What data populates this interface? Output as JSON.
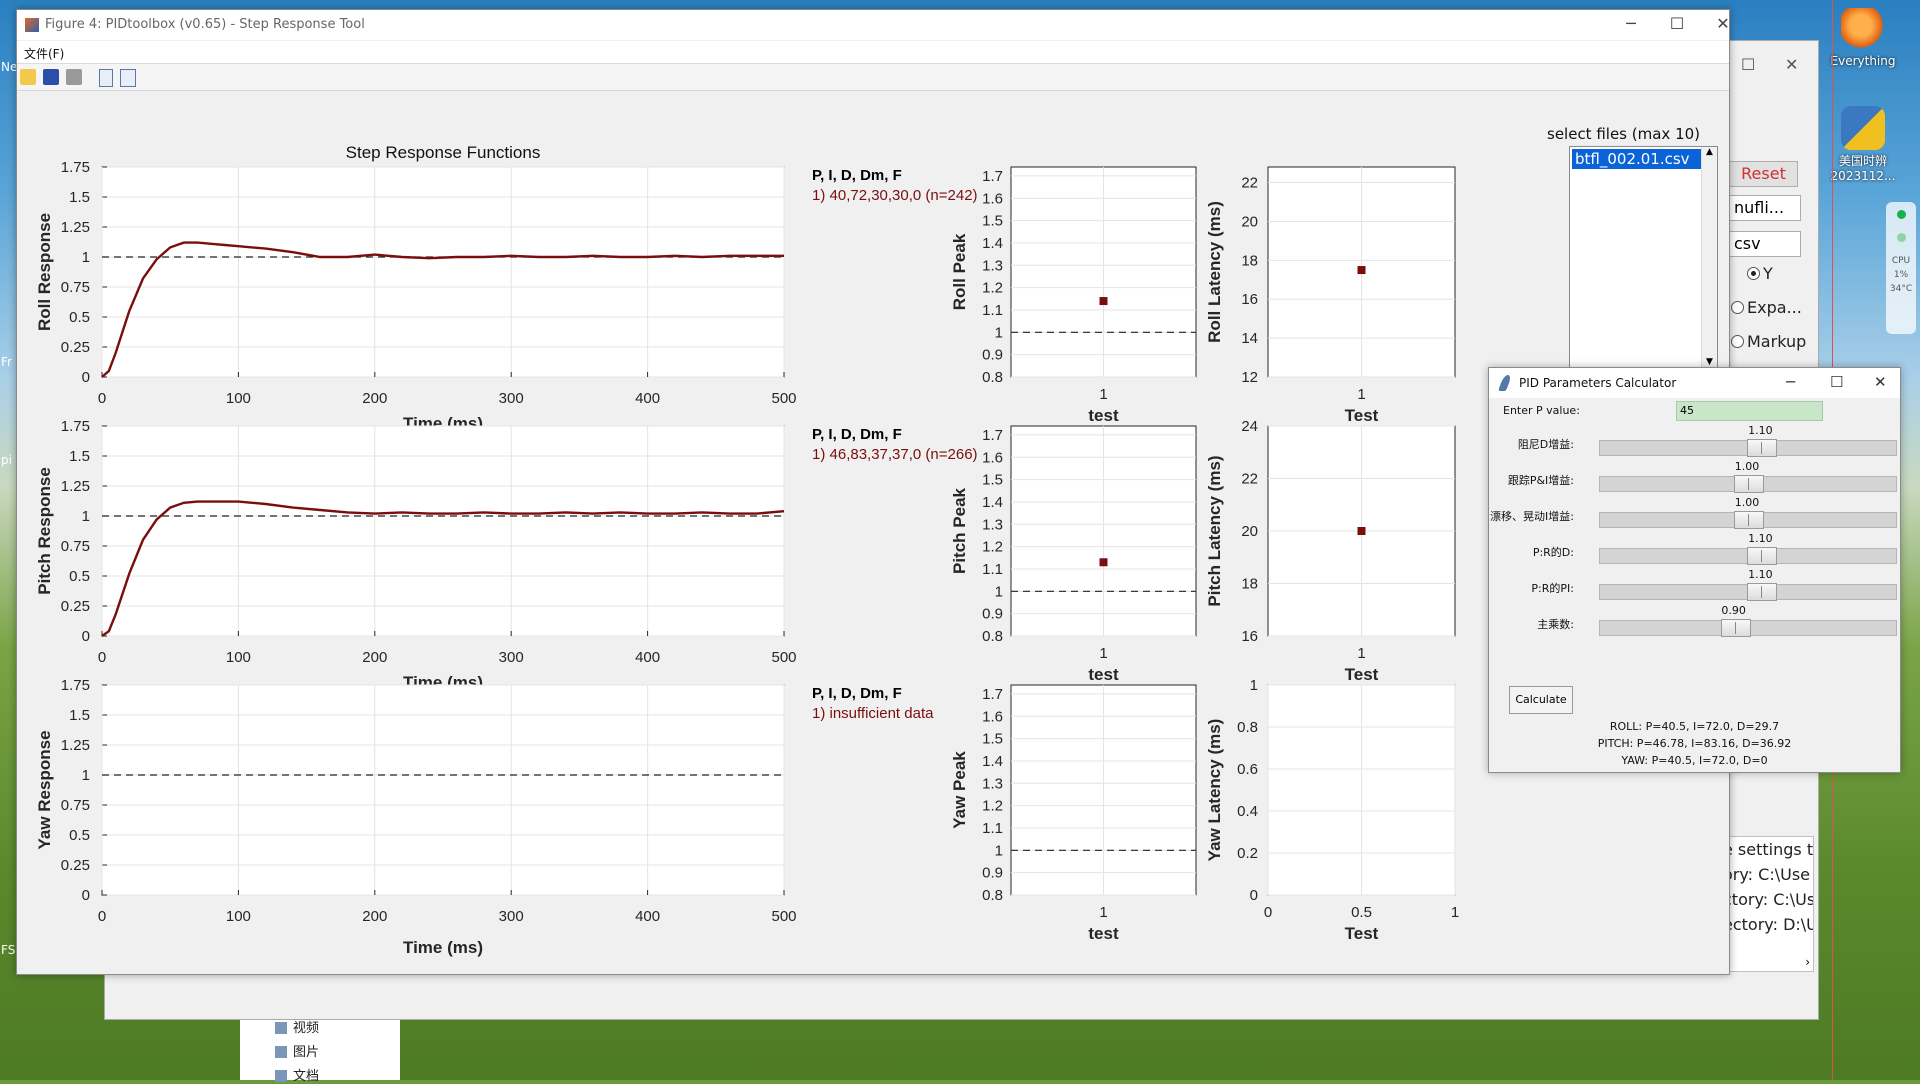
{
  "desktop": {
    "icons": [
      {
        "label": "Everything",
        "glyph_color": "#f08020"
      },
      {
        "label": "美国时辨",
        "sublabel": "2023112...",
        "glyph_color": "#3a78c0"
      }
    ],
    "side_fragments": [
      "Ne",
      "Fr",
      "pi",
      "FS"
    ],
    "cpu_widget": {
      "label": "CPU",
      "value": "1%",
      "temp": "34°C"
    }
  },
  "explorer": {
    "items": [
      "视频",
      "图片",
      "文档"
    ]
  },
  "bg_window": {
    "reset_label": "Reset",
    "combo1": "nufli...",
    "combo2": "csv",
    "radio_y": "Y",
    "radio_expand": "Expa...",
    "radio_markup": "Markup",
    "log_lines": [
      "e settings to",
      "ory: C:\\Use",
      "ctory: C:\\Us",
      "ectory: D:\\Us"
    ],
    "mid_mark": ")"
  },
  "figure": {
    "title": "Figure 4: PIDtoolbox (v0.65) - Step Response Tool",
    "menu_file": "文件(F)",
    "main_title": "Step Response Functions",
    "x_label": "Time (ms)",
    "legend_header": "P, I, D, Dm, F",
    "rows": [
      {
        "axis": "Roll",
        "ylabel": "Roll Response",
        "legend_line": "1) 40,72,30,30,0  (n=242)",
        "peak_label": "Roll Peak",
        "latency_label": "Roll Latency (ms)",
        "peak_xlabel": "test",
        "latency_xlabel": "Test",
        "peak_value": 1.14,
        "latency_value": 17.5,
        "latency_ticks": [
          "12",
          "14",
          "16",
          "18",
          "20",
          "22"
        ],
        "latency_range": [
          12,
          22.8
        ]
      },
      {
        "axis": "Pitch",
        "ylabel": "Pitch Response",
        "legend_line": "1) 46,83,37,37,0  (n=266)",
        "peak_label": "Pitch Peak",
        "latency_label": "Pitch Latency (ms)",
        "peak_xlabel": "test",
        "latency_xlabel": "Test",
        "peak_value": 1.13,
        "latency_value": 20,
        "latency_ticks": [
          "16",
          "18",
          "20",
          "22",
          "24"
        ],
        "latency_range": [
          16,
          24
        ]
      },
      {
        "axis": "Yaw",
        "ylabel": "Yaw Response",
        "legend_line": "1) insufficient data",
        "peak_label": "Yaw Peak",
        "latency_label": "Yaw Latency (ms)",
        "peak_xlabel": "test",
        "latency_xlabel": "Test",
        "peak_value": null,
        "latency_value": null,
        "latency_ticks": [
          "0",
          "0.2",
          "0.4",
          "0.6",
          "0.8",
          "1"
        ],
        "latency_range": [
          0,
          1
        ],
        "latency_xticks": [
          "0",
          "0.5",
          "1"
        ]
      }
    ],
    "response_yticks": [
      "0",
      "0.25",
      "0.5",
      "0.75",
      "1",
      "1.25",
      "1.5",
      "1.75"
    ],
    "response_xticks": [
      "0",
      "100",
      "200",
      "300",
      "400",
      "500"
    ],
    "peak_yticks": [
      "0.8",
      "0.9",
      "1",
      "1.1",
      "1.2",
      "1.3",
      "1.4",
      "1.5",
      "1.6",
      "1.7"
    ],
    "peak_xtick": "1",
    "file_select": {
      "label": "select files (max 10)",
      "selected": "btfl_002.01.csv"
    },
    "series_color": "#7a0e0e"
  },
  "chart_data": [
    {
      "type": "line",
      "title": "Step Response Functions",
      "xlabel": "Time (ms)",
      "ylabel": "Roll Response",
      "xlim": [
        0,
        500
      ],
      "ylim": [
        0,
        1.75
      ],
      "grid": true,
      "reference_line": 1,
      "x": [
        0,
        5,
        10,
        20,
        30,
        40,
        50,
        60,
        70,
        80,
        90,
        100,
        120,
        140,
        160,
        180,
        200,
        220,
        240,
        260,
        280,
        300,
        320,
        340,
        360,
        380,
        400,
        420,
        440,
        460,
        480,
        500
      ],
      "series": [
        {
          "values": [
            0,
            0.05,
            0.2,
            0.55,
            0.82,
            0.98,
            1.08,
            1.12,
            1.12,
            1.11,
            1.1,
            1.09,
            1.07,
            1.04,
            1.0,
            1.0,
            1.02,
            1.0,
            0.99,
            1.0,
            1.0,
            1.01,
            1.0,
            1.0,
            1.01,
            1.0,
            1.0,
            1.01,
            1.0,
            1.01,
            1.01,
            1.01
          ]
        }
      ]
    },
    {
      "type": "line",
      "xlabel": "Time (ms)",
      "ylabel": "Pitch Response",
      "xlim": [
        0,
        500
      ],
      "ylim": [
        0,
        1.75
      ],
      "grid": true,
      "reference_line": 1,
      "x": [
        0,
        5,
        10,
        20,
        30,
        40,
        50,
        60,
        70,
        80,
        90,
        100,
        120,
        140,
        160,
        180,
        200,
        220,
        240,
        260,
        280,
        300,
        320,
        340,
        360,
        380,
        400,
        420,
        440,
        460,
        480,
        500
      ],
      "series": [
        {
          "values": [
            0,
            0.04,
            0.18,
            0.52,
            0.8,
            0.97,
            1.07,
            1.11,
            1.12,
            1.12,
            1.12,
            1.12,
            1.1,
            1.07,
            1.05,
            1.03,
            1.02,
            1.03,
            1.02,
            1.02,
            1.03,
            1.02,
            1.02,
            1.03,
            1.02,
            1.03,
            1.02,
            1.02,
            1.03,
            1.02,
            1.02,
            1.04
          ]
        }
      ]
    },
    {
      "type": "line",
      "xlabel": "Time (ms)",
      "ylabel": "Yaw Response",
      "xlim": [
        0,
        500
      ],
      "ylim": [
        0,
        1.75
      ],
      "grid": true,
      "reference_line": 1,
      "x": [],
      "series": []
    }
  ],
  "pid_calc": {
    "title": "PID Parameters Calculator",
    "p_label": "Enter P value:",
    "p_value": "45",
    "sliders": [
      {
        "label": "阻尼D增益:",
        "value": "1.10",
        "position": 0.55
      },
      {
        "label": "跟踪P&I增益:",
        "value": "1.00",
        "position": 0.5
      },
      {
        "label": "漂移、晃动I增益:",
        "value": "1.00",
        "position": 0.5
      },
      {
        "label": "P:R的D:",
        "value": "1.10",
        "position": 0.55
      },
      {
        "label": "P:R的PI:",
        "value": "1.10",
        "position": 0.55
      },
      {
        "label": "主乘数:",
        "value": "0.90",
        "position": 0.45
      }
    ],
    "calculate_label": "Calculate",
    "results": [
      "ROLL: P=40.5, I=72.0, D=29.7",
      "PITCH: P=46.78, I=83.16, D=36.92",
      "YAW: P=40.5, I=72.0, D=0"
    ]
  }
}
